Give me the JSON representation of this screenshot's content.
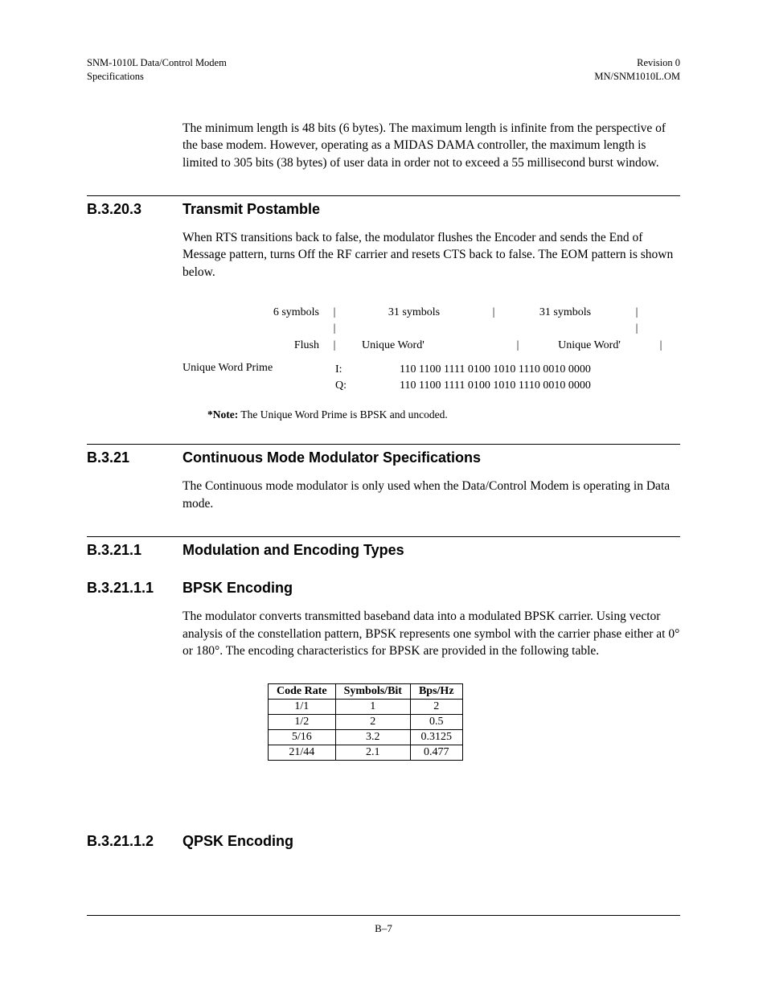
{
  "header": {
    "left_line1": "SNM-1010L Data/Control Modem",
    "left_line2": "Specifications",
    "right_line1": "Revision 0",
    "right_line2": "MN/SNM1010L.OM"
  },
  "intro_para": "The minimum length is 48 bits (6 bytes). The maximum length is infinite from the perspective of the base modem. However, operating as a MIDAS DAMA controller, the maximum length is limited to 305 bits (38 bytes) of user data in order not to exceed a 55 millisecond burst window.",
  "sections": {
    "s1": {
      "num": "B.3.20.3",
      "title": "Transmit Postamble"
    },
    "s2": {
      "num": "B.3.21",
      "title": "Continuous Mode Modulator Specifications"
    },
    "s3": {
      "num": "B.3.21.1",
      "title": "Modulation and Encoding Types"
    },
    "s4": {
      "num": "B.3.21.1.1",
      "title": "BPSK Encoding"
    },
    "s5": {
      "num": "B.3.21.1.2",
      "title": "QPSK Encoding"
    }
  },
  "postamble_para": "When RTS transitions back to false, the modulator flushes the Encoder and sends the End of Message pattern, turns Off the RF carrier and resets CTS back to false. The EOM pattern is shown below.",
  "diagram": {
    "top": {
      "c1": "6 symbols",
      "c2": "31 symbols",
      "c3": "31 symbols"
    },
    "bot": {
      "c1": "Flush",
      "c2": "Unique Word'",
      "c3": "Unique Word'"
    },
    "prime_label": "Unique Word Prime",
    "i_label": "I:",
    "q_label": "Q:",
    "i_bits": "110 1100 1111 0100 1010 1110 0010 0000",
    "q_bits": "110 1100 1111 0100 1010 1110 0010 0000"
  },
  "note_bold": "*Note:",
  "note_text": " The Unique Word Prime is BPSK and uncoded.",
  "continuous_para": "The Continuous mode modulator is only used when the Data/Control Modem is operating in Data mode.",
  "bpsk_para": "The modulator converts transmitted baseband data into a modulated BPSK carrier. Using vector analysis of the constellation pattern, BPSK represents one symbol with the carrier phase either at 0° or 180°. The encoding characteristics for BPSK are provided in the following table.",
  "table": {
    "headers": {
      "h1": "Code Rate",
      "h2": "Symbols/Bit",
      "h3": "Bps/Hz"
    },
    "rows": [
      {
        "c1": "1/1",
        "c2": "1",
        "c3": "2"
      },
      {
        "c1": "1/2",
        "c2": "2",
        "c3": "0.5"
      },
      {
        "c1": "5/16",
        "c2": "3.2",
        "c3": "0.3125"
      },
      {
        "c1": "21/44",
        "c2": "2.1",
        "c3": "0.477"
      }
    ]
  },
  "chart_data": {
    "type": "table",
    "title": "BPSK Encoding Characteristics",
    "columns": [
      "Code Rate",
      "Symbols/Bit",
      "Bps/Hz"
    ],
    "rows": [
      [
        "1/1",
        1,
        2
      ],
      [
        "1/2",
        2,
        0.5
      ],
      [
        "5/16",
        3.2,
        0.3125
      ],
      [
        "21/44",
        2.1,
        0.477
      ]
    ]
  },
  "page_num": "B–7"
}
